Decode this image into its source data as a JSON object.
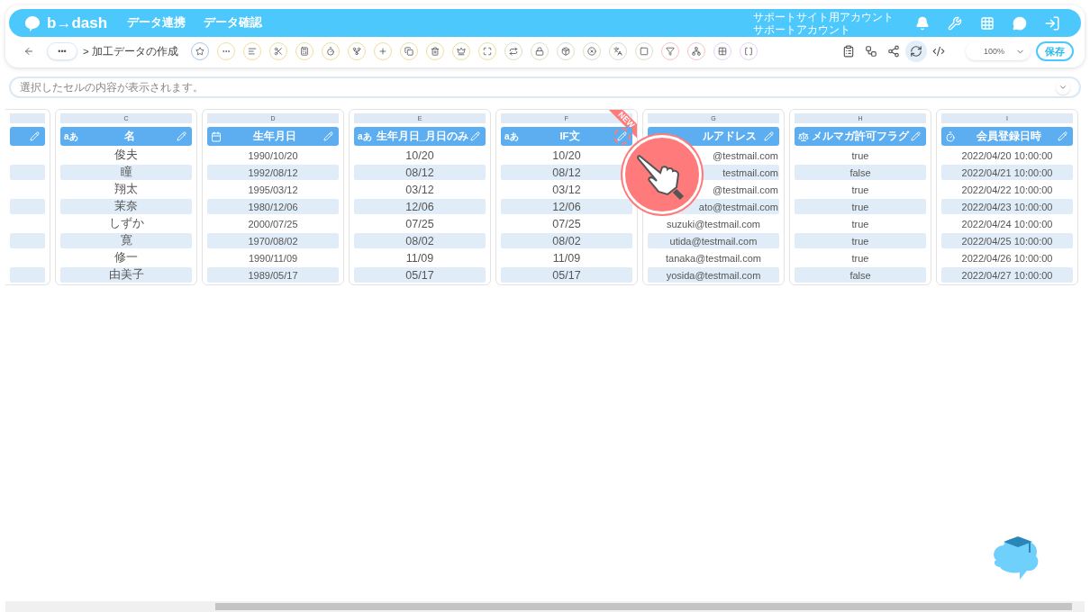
{
  "header": {
    "logo": "b→dash",
    "nav": [
      "データ連携",
      "データ確認"
    ],
    "account": [
      "サポートサイト用アカウント",
      "サポートアカウント"
    ]
  },
  "toolbar": {
    "more": "•••",
    "breadcrumb": "> 加工データの作成",
    "tools": [
      {
        "color": "#a9c6e8"
      },
      {
        "color": "#f3dca0"
      },
      {
        "color": "#f3dca0"
      },
      {
        "color": "#f3dca0"
      },
      {
        "color": "#f3dca0"
      },
      {
        "color": "#f3dca0"
      },
      {
        "color": "#f3dca0"
      },
      {
        "color": "#f3dca0"
      },
      {
        "color": "#f3dca0"
      },
      {
        "color": "#f3dca0"
      },
      {
        "color": "#f3dca0"
      },
      {
        "color": "#f3dca0"
      },
      {
        "color": "#d6e2c4"
      },
      {
        "color": "#d6e2c4"
      },
      {
        "color": "#d6e2c4"
      },
      {
        "color": "#d6e2c4"
      },
      {
        "color": "#d6e2c4"
      },
      {
        "color": "#d6e2c4"
      },
      {
        "color": "#f6c4c4"
      },
      {
        "color": "#f6c4c4"
      },
      {
        "color": "#ead0f6"
      },
      {
        "color": "#ead0f6"
      }
    ],
    "actions": [
      {
        "selected": false
      },
      {
        "selected": false
      },
      {
        "selected": false
      },
      {
        "selected": true
      },
      {
        "selected": false
      }
    ],
    "zoom": "100%",
    "save": "保存"
  },
  "formula_bar": {
    "placeholder": "選択したセルの内容が表示されます。"
  },
  "columns": [
    {
      "letter": "C",
      "title": "名",
      "kind": "text",
      "type_label": "aあ",
      "highlighted": false,
      "rows": [
        {
          "text": "俊夫",
          "covered": false
        },
        {
          "text": "瞳",
          "covered": false
        },
        {
          "text": "翔太",
          "covered": false
        },
        {
          "text": "茉奈",
          "covered": false
        },
        {
          "text": "しずか",
          "covered": false
        },
        {
          "text": "寛",
          "covered": false
        },
        {
          "text": "修一",
          "covered": false
        },
        {
          "text": "由美子",
          "covered": false
        }
      ]
    },
    {
      "letter": "D",
      "title": "生年月日",
      "kind": "date",
      "highlighted": false,
      "rows": [
        {
          "text": "1990/10/20",
          "covered": false
        },
        {
          "text": "1992/08/12",
          "covered": false
        },
        {
          "text": "1995/03/12",
          "covered": false
        },
        {
          "text": "1980/12/06",
          "covered": false
        },
        {
          "text": "2000/07/25",
          "covered": false
        },
        {
          "text": "1970/08/02",
          "covered": false
        },
        {
          "text": "1990/11/09",
          "covered": false
        },
        {
          "text": "1989/05/17",
          "covered": false
        }
      ]
    },
    {
      "letter": "E",
      "title": "生年月日_月日のみ",
      "kind": "text",
      "type_label": "aあ",
      "highlighted": false,
      "rows": [
        {
          "text": "10/20",
          "covered": false
        },
        {
          "text": "08/12",
          "covered": false
        },
        {
          "text": "03/12",
          "covered": false
        },
        {
          "text": "12/06",
          "covered": false
        },
        {
          "text": "07/25",
          "covered": false
        },
        {
          "text": "08/02",
          "covered": false
        },
        {
          "text": "11/09",
          "covered": false
        },
        {
          "text": "05/17",
          "covered": false
        }
      ]
    },
    {
      "letter": "F",
      "title": "IF文",
      "kind": "text",
      "type_label": "aあ",
      "badge": "NEW",
      "highlighted": true,
      "rows": [
        {
          "text": "10/20",
          "covered": false
        },
        {
          "text": "08/12",
          "covered": false
        },
        {
          "text": "03/12",
          "covered": false
        },
        {
          "text": "12/06",
          "covered": false
        },
        {
          "text": "07/25",
          "covered": false
        },
        {
          "text": "08/02",
          "covered": false
        },
        {
          "text": "11/09",
          "covered": false
        },
        {
          "text": "05/17",
          "covered": false
        }
      ]
    },
    {
      "letter": "G",
      "title": "ルアドレス",
      "kind": "covered",
      "highlighted": false,
      "rows": [
        {
          "text": "@testmail.com",
          "covered": true
        },
        {
          "text": "testmail.com",
          "covered": true
        },
        {
          "text": "@testmail.com",
          "covered": true
        },
        {
          "text": "ato@testmail.com",
          "covered": true
        },
        {
          "text": "suzuki@testmail.com",
          "covered": false
        },
        {
          "text": "utida@testmail.com",
          "covered": false
        },
        {
          "text": "tanaka@testmail.com",
          "covered": false
        },
        {
          "text": "yosida@testmail.com",
          "covered": false
        }
      ]
    },
    {
      "letter": "H",
      "title": "メルマガ許可フラグ",
      "kind": "flag",
      "highlighted": false,
      "rows": [
        {
          "text": "true",
          "covered": false
        },
        {
          "text": "false",
          "covered": false
        },
        {
          "text": "true",
          "covered": false
        },
        {
          "text": "true",
          "covered": false
        },
        {
          "text": "true",
          "covered": false
        },
        {
          "text": "true",
          "covered": false
        },
        {
          "text": "true",
          "covered": false
        },
        {
          "text": "false",
          "covered": false
        }
      ]
    },
    {
      "letter": "I",
      "title": "会員登録日時",
      "kind": "datetime",
      "highlighted": false,
      "rows": [
        {
          "text": "2022/04/20 10:00:00",
          "covered": false
        },
        {
          "text": "2022/04/21 10:00:00",
          "covered": false
        },
        {
          "text": "2022/04/22 10:00:00",
          "covered": false
        },
        {
          "text": "2022/04/23 10:00:00",
          "covered": false
        },
        {
          "text": "2022/04/24 10:00:00",
          "covered": false
        },
        {
          "text": "2022/04/25 10:00:00",
          "covered": false
        },
        {
          "text": "2022/04/26 10:00:00",
          "covered": false
        },
        {
          "text": "2022/04/27 10:00:00",
          "covered": false
        }
      ]
    }
  ]
}
